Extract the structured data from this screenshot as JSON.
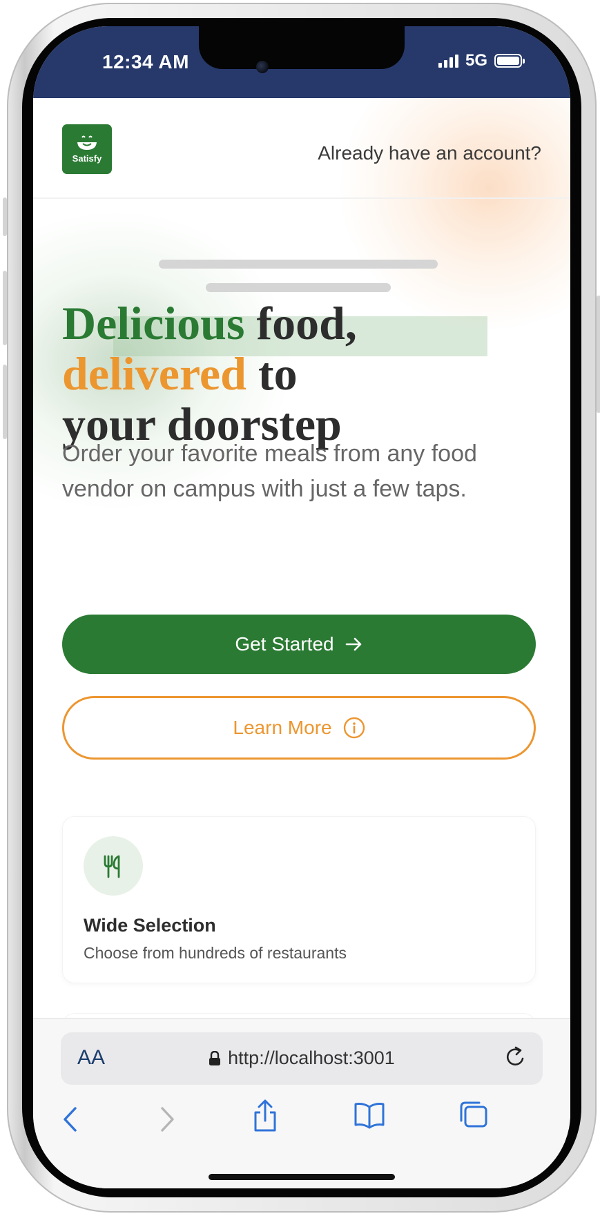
{
  "status_bar": {
    "time": "12:34 AM",
    "network": "5G"
  },
  "header": {
    "logo_text": "Satisfy",
    "signin_link": "Already have an account?"
  },
  "hero": {
    "headline_part1": "Delicious",
    "headline_part2": " food,",
    "headline_part3": "delivered",
    "headline_part4": " to",
    "headline_part5": "your doorstep",
    "subtext": "Order your favorite meals from any food vendor on campus with just a few taps."
  },
  "actions": {
    "primary_label": "Get Started",
    "secondary_label": "Learn More"
  },
  "features": [
    {
      "icon": "utensils-icon",
      "title": "Wide Selection",
      "description": "Choose from hundreds of restaurants"
    }
  ],
  "browser": {
    "aa_label": "AA",
    "url": "http://localhost:3001"
  },
  "colors": {
    "brand_green": "#2a7a33",
    "accent_orange": "#ec9630",
    "status_bar": "#27396b"
  }
}
